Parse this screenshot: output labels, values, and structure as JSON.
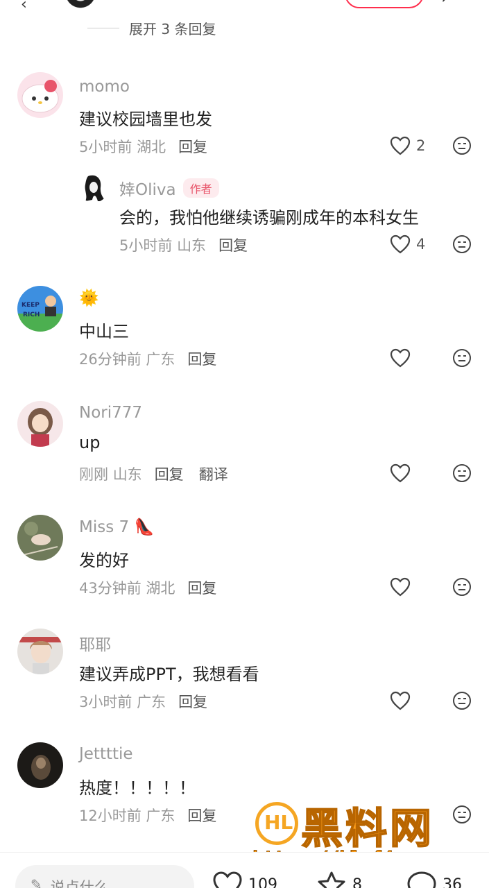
{
  "top": {
    "back_icon": "back-arrow-icon",
    "share_icon": "share-icon"
  },
  "expand": {
    "label": "展开 3 条回复"
  },
  "comments": [
    {
      "name": "momo",
      "content": "建议校园墙里也发",
      "time": "5小时前",
      "location": "湖北",
      "reply": "回复",
      "likes": "2"
    },
    {
      "name": "婞Oliva",
      "author_tag": "作者",
      "content": "会的，我怕他继续诱骗刚成年的本科女生",
      "time": "5小时前",
      "location": "山东",
      "reply": "回复",
      "likes": "4"
    },
    {
      "name": "🌞",
      "content": "中山三",
      "time": "26分钟前",
      "location": "广东",
      "reply": "回复",
      "likes": ""
    },
    {
      "name": "Nori777",
      "content": "up",
      "time": "刚刚",
      "location": "山东",
      "reply": "回复",
      "translate": "翻译",
      "likes": ""
    },
    {
      "name": "Miss 7 👠",
      "content": "发的好",
      "time": "43分钟前",
      "location": "湖北",
      "reply": "回复",
      "likes": ""
    },
    {
      "name": "耶耶",
      "content": "建议弄成PPT，我想看看",
      "time": "3小时前",
      "location": "广东",
      "reply": "回复",
      "likes": ""
    },
    {
      "name": "Jettttie",
      "content": "热度！！！！！",
      "time": "12小时前",
      "location": "广东",
      "reply": "回复",
      "likes": ""
    }
  ],
  "watermark": {
    "logo": "HL",
    "title": "黑料网",
    "url": "https://hlwf4.com"
  },
  "bottom": {
    "placeholder": "说点什么...",
    "likes": "109",
    "stars": "8",
    "comments": "36"
  },
  "colors": {
    "accent": "#ff2e4d",
    "author_tag_bg": "#fdebee",
    "author_tag_text": "#e8546a",
    "muted": "#999999"
  }
}
